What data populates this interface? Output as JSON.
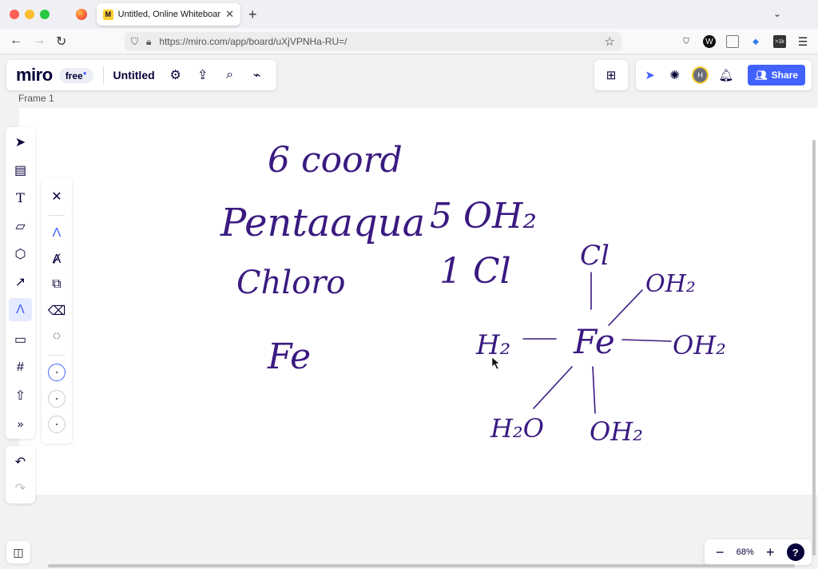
{
  "browser": {
    "tab_title": "Untitled, Online Whiteboard for",
    "tab_favicon": "M",
    "url": "https://miro.com/app/board/uXjVPNHa-RU=/",
    "ext_badge": ">1k",
    "ext_w": "W"
  },
  "miro": {
    "logo": "miro",
    "plan": "free",
    "board_title": "Untitled",
    "frame_label": "Frame 1",
    "share_label": "Share",
    "avatar_initial": "H",
    "zoom": "68%"
  },
  "ink": {
    "color": "#3a1a80",
    "line1": "6 coord",
    "line2": "Pentaaqua",
    "line3": "Chloro",
    "line4": "Fe",
    "count1": "5 OH₂",
    "count2": "1 Cl",
    "top_ligand": "Cl",
    "center": "Fe",
    "upper_right": "OH₂",
    "right": "OH₂",
    "left": "H₂",
    "lower_left": "H₂O",
    "bottom": "OH₂"
  },
  "icons": {
    "select": "cursor-icon",
    "templates": "templates-icon",
    "text": "text-icon",
    "sticky": "sticky-note-icon",
    "shapes": "shapes-icon",
    "connector": "arrow-icon",
    "pen": "pen-icon",
    "comment": "comment-icon",
    "frame": "frame-icon",
    "upload": "upload-icon",
    "more": "more-icon"
  }
}
